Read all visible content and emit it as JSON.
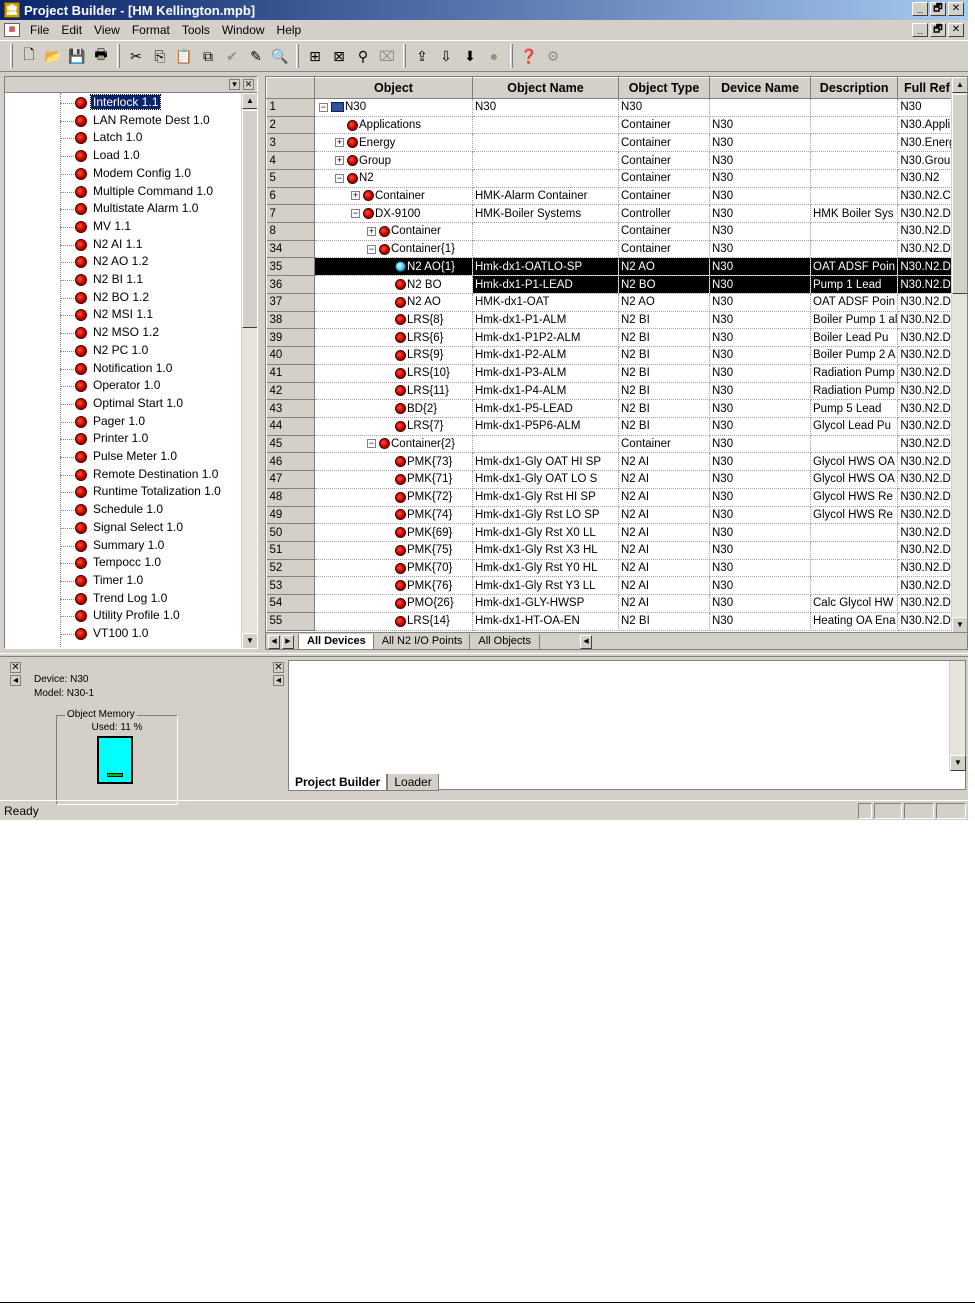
{
  "window": {
    "title": "Project Builder - [HM Kellington.mpb]",
    "minimize": "_",
    "restore": "🗗",
    "close": "✕"
  },
  "menu": [
    "File",
    "Edit",
    "View",
    "Format",
    "Tools",
    "Window",
    "Help"
  ],
  "toolbar": {
    "icons": [
      "new-file-icon",
      "open-folder-icon",
      "save-icon",
      "print-icon",
      "cut-icon",
      "copy-icon",
      "paste-icon",
      "paste-special-icon",
      "check-icon",
      "edit-icon",
      "find-icon",
      "compile-icon",
      "download-icon",
      "network-icon",
      "disabled-icon",
      "upload-icon",
      "commission-icon",
      "command-icon",
      "record-icon",
      "help-icon",
      "whats-this-icon"
    ]
  },
  "tree": {
    "items": [
      {
        "label": "Interlock 1.1",
        "selected": true
      },
      {
        "label": "LAN Remote Dest 1.0"
      },
      {
        "label": "Latch 1.0"
      },
      {
        "label": "Load 1.0"
      },
      {
        "label": "Modem Config 1.0"
      },
      {
        "label": "Multiple Command 1.0"
      },
      {
        "label": "Multistate Alarm 1.0"
      },
      {
        "label": "MV 1.1"
      },
      {
        "label": "N2 AI 1.1"
      },
      {
        "label": "N2 AO 1.2"
      },
      {
        "label": "N2 BI 1.1"
      },
      {
        "label": "N2 BO 1.2"
      },
      {
        "label": "N2 MSI 1.1"
      },
      {
        "label": "N2 MSO 1.2"
      },
      {
        "label": "N2 PC 1.0"
      },
      {
        "label": "Notification 1.0"
      },
      {
        "label": "Operator 1.0"
      },
      {
        "label": "Optimal Start 1.0"
      },
      {
        "label": "Pager 1.0"
      },
      {
        "label": "Printer 1.0"
      },
      {
        "label": "Pulse Meter 1.0"
      },
      {
        "label": "Remote Destination 1.0"
      },
      {
        "label": "Runtime Totalization 1.0"
      },
      {
        "label": "Schedule 1.0"
      },
      {
        "label": "Signal Select 1.0"
      },
      {
        "label": "Summary 1.0"
      },
      {
        "label": "Tempocc 1.0"
      },
      {
        "label": "Timer 1.0"
      },
      {
        "label": "Trend Log 1.0"
      },
      {
        "label": "Utility Profile 1.0"
      },
      {
        "label": "VT100 1.0"
      }
    ]
  },
  "grid": {
    "columns": [
      "",
      "Object",
      "Object Name",
      "Object Type",
      "Device Name",
      "Description",
      "Full Ref"
    ],
    "rows": [
      {
        "num": "1",
        "indent": 0,
        "expander": "−",
        "icon": "device",
        "object": "N30",
        "name": "N30",
        "type": "N30",
        "device": "",
        "desc": "",
        "ref": "N30"
      },
      {
        "num": "2",
        "indent": 1,
        "expander": "",
        "icon": "red",
        "object": "Applications",
        "name": "",
        "type": "Container",
        "device": "N30",
        "desc": "",
        "ref": "N30.Appli"
      },
      {
        "num": "3",
        "indent": 1,
        "expander": "+",
        "icon": "red",
        "object": "Energy",
        "name": "",
        "type": "Container",
        "device": "N30",
        "desc": "",
        "ref": "N30.Energ"
      },
      {
        "num": "4",
        "indent": 1,
        "expander": "+",
        "icon": "red",
        "object": "Group",
        "name": "",
        "type": "Container",
        "device": "N30",
        "desc": "",
        "ref": "N30.Grou"
      },
      {
        "num": "5",
        "indent": 1,
        "expander": "−",
        "icon": "red",
        "object": "N2",
        "name": "",
        "type": "Container",
        "device": "N30",
        "desc": "",
        "ref": "N30.N2"
      },
      {
        "num": "6",
        "indent": 2,
        "expander": "+",
        "icon": "red",
        "object": "Container",
        "name": "HMK-Alarm Container",
        "type": "Container",
        "device": "N30",
        "desc": "",
        "ref": "N30.N2.C"
      },
      {
        "num": "7",
        "indent": 2,
        "expander": "−",
        "icon": "red",
        "object": "DX-9100",
        "name": "HMK-Boiler Systems",
        "type": "Controller",
        "device": "N30",
        "desc": "HMK Boiler Sys",
        "ref": "N30.N2.D"
      },
      {
        "num": "8",
        "indent": 3,
        "expander": "+",
        "icon": "red",
        "object": "Container",
        "name": "",
        "type": "Container",
        "device": "N30",
        "desc": "",
        "ref": "N30.N2.D"
      },
      {
        "num": "34",
        "indent": 3,
        "expander": "−",
        "icon": "red",
        "object": "Container{1}",
        "name": "",
        "type": "Container",
        "device": "N30",
        "desc": "",
        "ref": "N30.N2.D"
      },
      {
        "num": "35",
        "indent": 4,
        "expander": "",
        "icon": "cyan",
        "object": "N2 AO{1}",
        "name": "Hmk-dx1-OATLO-SP",
        "type": "N2 AO",
        "device": "N30",
        "desc": "OAT ADSF Poin",
        "ref": "N30.N2.D",
        "selected": true
      },
      {
        "num": "36",
        "indent": 4,
        "expander": "",
        "icon": "red",
        "object": "N2 BO",
        "name": "Hmk-dx1-P1-LEAD",
        "type": "N2 BO",
        "device": "N30",
        "desc": "Pump 1 Lead",
        "ref": "N30.N2.D",
        "selected": true,
        "editing": true
      },
      {
        "num": "37",
        "indent": 4,
        "expander": "",
        "icon": "red",
        "object": "N2 AO",
        "name": "HMK-dx1-OAT",
        "type": "N2 AO",
        "device": "N30",
        "desc": "OAT ADSF Poin",
        "ref": "N30.N2.D"
      },
      {
        "num": "38",
        "indent": 4,
        "expander": "",
        "icon": "red",
        "object": "LRS{8}",
        "name": "Hmk-dx1-P1-ALM",
        "type": "N2 BI",
        "device": "N30",
        "desc": "Boiler Pump 1 al",
        "ref": "N30.N2.D"
      },
      {
        "num": "39",
        "indent": 4,
        "expander": "",
        "icon": "red",
        "object": "LRS{6}",
        "name": "Hmk-dx1-P1P2-ALM",
        "type": "N2 BI",
        "device": "N30",
        "desc": "Boiler Lead Pu",
        "ref": "N30.N2.D"
      },
      {
        "num": "40",
        "indent": 4,
        "expander": "",
        "icon": "red",
        "object": "LRS{9}",
        "name": "Hmk-dx1-P2-ALM",
        "type": "N2 BI",
        "device": "N30",
        "desc": "Boiler Pump 2 A",
        "ref": "N30.N2.D"
      },
      {
        "num": "41",
        "indent": 4,
        "expander": "",
        "icon": "red",
        "object": "LRS{10}",
        "name": "Hmk-dx1-P3-ALM",
        "type": "N2 BI",
        "device": "N30",
        "desc": "Radiation Pump",
        "ref": "N30.N2.D"
      },
      {
        "num": "42",
        "indent": 4,
        "expander": "",
        "icon": "red",
        "object": "LRS{11}",
        "name": "Hmk-dx1-P4-ALM",
        "type": "N2 BI",
        "device": "N30",
        "desc": "Radiation Pump",
        "ref": "N30.N2.D"
      },
      {
        "num": "43",
        "indent": 4,
        "expander": "",
        "icon": "red",
        "object": "BD{2}",
        "name": "Hmk-dx1-P5-LEAD",
        "type": "N2 BI",
        "device": "N30",
        "desc": "Pump 5 Lead",
        "ref": "N30.N2.D"
      },
      {
        "num": "44",
        "indent": 4,
        "expander": "",
        "icon": "red",
        "object": "LRS{7}",
        "name": "Hmk-dx1-P5P6-ALM",
        "type": "N2 BI",
        "device": "N30",
        "desc": "Glycol Lead Pu",
        "ref": "N30.N2.D"
      },
      {
        "num": "45",
        "indent": 3,
        "expander": "−",
        "icon": "red",
        "object": "Container{2}",
        "name": "",
        "type": "Container",
        "device": "N30",
        "desc": "",
        "ref": "N30.N2.D"
      },
      {
        "num": "46",
        "indent": 4,
        "expander": "",
        "icon": "red",
        "object": "PMK{73}",
        "name": "Hmk-dx1-Gly OAT HI SP",
        "type": "N2 AI",
        "device": "N30",
        "desc": "Glycol HWS OA",
        "ref": "N30.N2.D"
      },
      {
        "num": "47",
        "indent": 4,
        "expander": "",
        "icon": "red",
        "object": "PMK{71}",
        "name": "Hmk-dx1-Gly OAT LO S",
        "type": "N2 AI",
        "device": "N30",
        "desc": "Glycol HWS OA",
        "ref": "N30.N2.D"
      },
      {
        "num": "48",
        "indent": 4,
        "expander": "",
        "icon": "red",
        "object": "PMK{72}",
        "name": "Hmk-dx1-Gly Rst HI SP",
        "type": "N2 AI",
        "device": "N30",
        "desc": "Glycol HWS Re",
        "ref": "N30.N2.D"
      },
      {
        "num": "49",
        "indent": 4,
        "expander": "",
        "icon": "red",
        "object": "PMK{74}",
        "name": "Hmk-dx1-Gly Rst LO SP",
        "type": "N2 AI",
        "device": "N30",
        "desc": "Glycol HWS Re",
        "ref": "N30.N2.D"
      },
      {
        "num": "50",
        "indent": 4,
        "expander": "",
        "icon": "red",
        "object": "PMK{69}",
        "name": "Hmk-dx1-Gly Rst X0 LL",
        "type": "N2 AI",
        "device": "N30",
        "desc": "",
        "ref": "N30.N2.D"
      },
      {
        "num": "51",
        "indent": 4,
        "expander": "",
        "icon": "red",
        "object": "PMK{75}",
        "name": "Hmk-dx1-Gly Rst X3 HL",
        "type": "N2 AI",
        "device": "N30",
        "desc": "",
        "ref": "N30.N2.D"
      },
      {
        "num": "52",
        "indent": 4,
        "expander": "",
        "icon": "red",
        "object": "PMK{70}",
        "name": "Hmk-dx1-Gly Rst Y0 HL",
        "type": "N2 AI",
        "device": "N30",
        "desc": "",
        "ref": "N30.N2.D"
      },
      {
        "num": "53",
        "indent": 4,
        "expander": "",
        "icon": "red",
        "object": "PMK{76}",
        "name": "Hmk-dx1-Gly Rst Y3 LL",
        "type": "N2 AI",
        "device": "N30",
        "desc": "",
        "ref": "N30.N2.D"
      },
      {
        "num": "54",
        "indent": 4,
        "expander": "",
        "icon": "red",
        "object": "PMO{26}",
        "name": "Hmk-dx1-GLY-HWSP",
        "type": "N2 AI",
        "device": "N30",
        "desc": "Calc Glycol HW",
        "ref": "N30.N2.D"
      },
      {
        "num": "55",
        "indent": 4,
        "expander": "",
        "icon": "red",
        "object": "LRS{14}",
        "name": "Hmk-dx1-HT-OA-EN",
        "type": "N2 BI",
        "device": "N30",
        "desc": "Heating OA Ena",
        "ref": "N30.N2.D"
      }
    ]
  },
  "sheet_tabs": [
    "All Devices",
    "All N2 I/O Points",
    "All Objects"
  ],
  "device_info": {
    "device": "Device: N30",
    "model": "Model: N30-1",
    "memory_label": "Object Memory",
    "used": "Used: 11 %",
    "used_fraction": 0.11
  },
  "bottom_tabs": [
    "Project Builder",
    "Loader"
  ],
  "status": {
    "text": "Ready"
  },
  "colors": {
    "selection": "#000000",
    "title_start": "#0a246a",
    "title_end": "#a6caf0",
    "gauge": "#00ffff"
  }
}
